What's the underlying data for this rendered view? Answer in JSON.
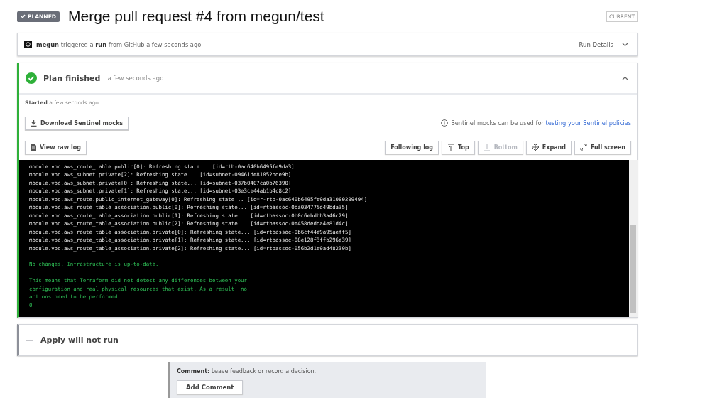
{
  "header": {
    "status": "PLANNED",
    "title": "Merge pull request #4 from megun/test",
    "tag": "CURRENT"
  },
  "run_card": {
    "text": "**megun** triggered a **run** from GitHub a few seconds ago",
    "details": "Run Details",
    "expanded": false
  },
  "plan_card": {
    "title": "Plan finished",
    "time": "a few seconds ago",
    "succeeded": true,
    "expanded": true,
    "started": "**Started** a few seconds ago",
    "download_button": "Download Sentinel mocks",
    "info": "Sentinel mocks can be used for",
    "info_link": "testing your Sentinel policies",
    "raw_log_button": "View raw log",
    "log_buttons": [
      {
        "kind": "text",
        "label": "Following log",
        "disabled": false
      },
      {
        "kind": "top",
        "label": "Top",
        "disabled": false
      },
      {
        "kind": "bottom",
        "label": "Bottom",
        "disabled": true
      },
      {
        "kind": "expand",
        "label": "Expand",
        "disabled": false
      },
      {
        "kind": "fullscreen",
        "label": "Full screen",
        "disabled": false
      }
    ],
    "log": [
      {
        "kind": "normal",
        "lines": [
          "module.vpc.aws_route_table.public[0]: Refreshing state... [id=rtb-0ac640b6495fe9da3]",
          "module.vpc.aws_subnet.private[2]: Refreshing state... [id=subnet-09461de81852bde9b]",
          "module.vpc.aws_subnet.private[0]: Refreshing state... [id=subnet-037b0407ca0b76390]",
          "module.vpc.aws_subnet.private[1]: Refreshing state... [id=subnet-03e3ce44ab1b4c8c2]",
          "module.vpc.aws_route.public_internet_gateway[0]: Refreshing state... [id=r-rtb-0ac640b6495fe9da31080289494]",
          "module.vpc.aws_route_table_association.public[0]: Refreshing state... [id=rtbassoc-0ba034775d49bda35]",
          "module.vpc.aws_route_table_association.public[1]: Refreshing state... [id=rtbassoc-0b0c6ebdbb3a46c29]",
          "module.vpc.aws_route_table_association.public[2]: Refreshing state... [id=rtbassoc-0e458dedda4e81d4c]",
          "module.vpc.aws_route_table_association.private[0]: Refreshing state... [id=rtbassoc-0b6cf44e9a95aeff5]",
          "module.vpc.aws_route_table_association.private[1]: Refreshing state... [id=rtbassoc-08e128f3ffb296e39]",
          "module.vpc.aws_route_table_association.private[2]: Refreshing state... [id=rtbassoc-056b2d1e9ad48239b]"
        ]
      },
      {
        "kind": "success",
        "lines": [
          "No changes. Infrastructure is up-to-date."
        ]
      },
      {
        "kind": "success",
        "lines": [
          "This means that Terraform did not detect any differences between your",
          "configuration and real physical resources that exist. As a result, no",
          "actions need to be performed.",
          "0"
        ]
      }
    ]
  },
  "apply_card": {
    "title": "Apply will not run",
    "skipped": true
  },
  "comment": {
    "text": "**Comment:** Leave feedback or record a decision.",
    "button": "Add Comment"
  }
}
